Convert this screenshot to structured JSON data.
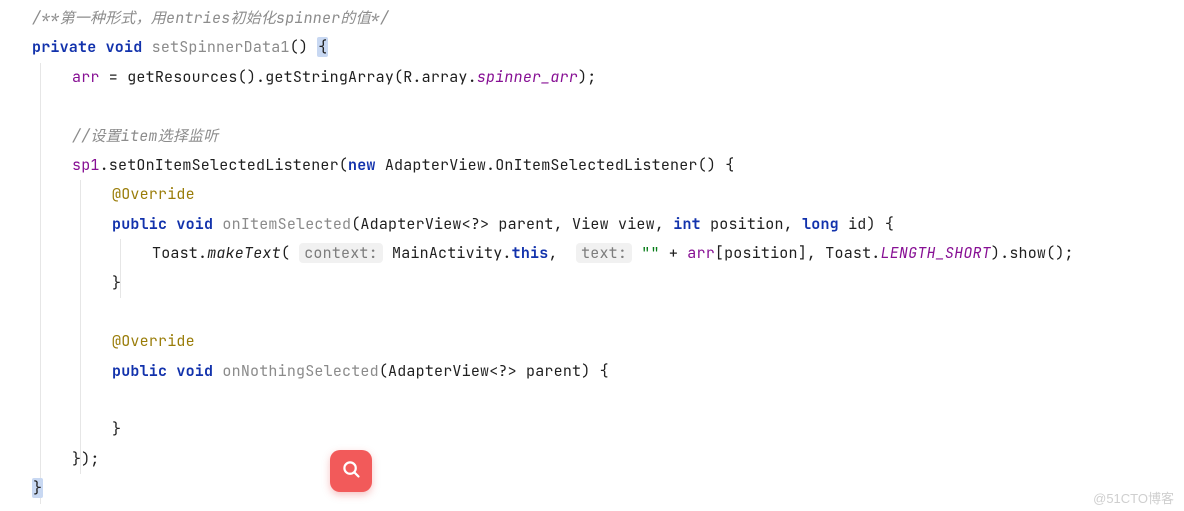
{
  "watermark": "@51CTO博客",
  "button": {
    "name": "search"
  },
  "code": {
    "lines": [
      {
        "indent": 0,
        "hl": false,
        "tokens": [
          {
            "cls": "c-comment",
            "t": "/**第一种形式，用entries初始化spinner的值*/"
          }
        ]
      },
      {
        "indent": 0,
        "hl": false,
        "tokens": [
          {
            "cls": "c-kw",
            "t": "private "
          },
          {
            "cls": "c-kw",
            "t": "void "
          },
          {
            "cls": "c-decl",
            "t": "setSpinnerData1"
          },
          {
            "cls": "c-punc",
            "t": "() "
          },
          {
            "cls": "c-punc hl-brace",
            "t": "{"
          }
        ]
      },
      {
        "indent": 1,
        "hl": false,
        "tokens": [
          {
            "cls": "c-field",
            "t": "arr"
          },
          {
            "cls": "c-punc",
            "t": " = "
          },
          {
            "cls": "c-method",
            "t": "getResources().getStringArray(R.array."
          },
          {
            "cls": "c-staticit",
            "t": "spinner_arr"
          },
          {
            "cls": "c-punc",
            "t": ");"
          }
        ]
      },
      {
        "indent": 1,
        "hl": false,
        "tokens": [
          {
            "cls": "c-punc",
            "t": ""
          }
        ]
      },
      {
        "indent": 1,
        "hl": false,
        "tokens": [
          {
            "cls": "c-comment",
            "t": "//设置item选择监听"
          }
        ]
      },
      {
        "indent": 1,
        "hl": false,
        "tokens": [
          {
            "cls": "c-field",
            "t": "sp1"
          },
          {
            "cls": "c-punc",
            "t": ".setOnItemSelectedListener("
          },
          {
            "cls": "c-kw",
            "t": "new "
          },
          {
            "cls": "c-ident",
            "t": "AdapterView.OnItemSelectedListener() {"
          }
        ]
      },
      {
        "indent": 2,
        "hl": false,
        "tokens": [
          {
            "cls": "c-anno",
            "t": "@Override"
          }
        ]
      },
      {
        "indent": 2,
        "hl": false,
        "tokens": [
          {
            "cls": "c-kw",
            "t": "public "
          },
          {
            "cls": "c-kw",
            "t": "void "
          },
          {
            "cls": "c-decl",
            "t": "onItemSelected"
          },
          {
            "cls": "c-punc",
            "t": "(AdapterView<?> parent, View view, "
          },
          {
            "cls": "c-kw",
            "t": "int "
          },
          {
            "cls": "c-ident",
            "t": "position, "
          },
          {
            "cls": "c-kw",
            "t": "long "
          },
          {
            "cls": "c-ident",
            "t": "id) {"
          }
        ]
      },
      {
        "indent": 3,
        "hl": false,
        "tokens": [
          {
            "cls": "c-ident",
            "t": "Toast."
          },
          {
            "cls": "c-static",
            "t": "makeText"
          },
          {
            "cls": "c-punc",
            "t": "( "
          },
          {
            "cls": "c-hint",
            "t": "context:"
          },
          {
            "cls": "c-punc",
            "t": " MainActivity."
          },
          {
            "cls": "c-kw",
            "t": "this"
          },
          {
            "cls": "c-punc",
            "t": ",  "
          },
          {
            "cls": "c-hint",
            "t": "text:"
          },
          {
            "cls": "c-punc",
            "t": " "
          },
          {
            "cls": "c-str",
            "t": "\"\""
          },
          {
            "cls": "c-punc",
            "t": " + "
          },
          {
            "cls": "c-field",
            "t": "arr"
          },
          {
            "cls": "c-punc",
            "t": "[position], Toast."
          },
          {
            "cls": "c-staticit",
            "t": "LENGTH_SHORT"
          },
          {
            "cls": "c-punc",
            "t": ").show();"
          }
        ]
      },
      {
        "indent": 2,
        "hl": false,
        "tokens": [
          {
            "cls": "c-punc",
            "t": "}"
          }
        ]
      },
      {
        "indent": 2,
        "hl": false,
        "tokens": [
          {
            "cls": "c-punc",
            "t": ""
          }
        ]
      },
      {
        "indent": 2,
        "hl": false,
        "tokens": [
          {
            "cls": "c-anno",
            "t": "@Override"
          }
        ]
      },
      {
        "indent": 2,
        "hl": false,
        "tokens": [
          {
            "cls": "c-kw",
            "t": "public "
          },
          {
            "cls": "c-kw",
            "t": "void "
          },
          {
            "cls": "c-decl",
            "t": "onNothingSelected"
          },
          {
            "cls": "c-punc",
            "t": "(AdapterView<?> parent) {"
          }
        ]
      },
      {
        "indent": 2,
        "hl": false,
        "tokens": [
          {
            "cls": "c-punc",
            "t": ""
          }
        ]
      },
      {
        "indent": 2,
        "hl": false,
        "tokens": [
          {
            "cls": "c-punc",
            "t": "}"
          }
        ]
      },
      {
        "indent": 1,
        "hl": false,
        "tokens": [
          {
            "cls": "c-punc",
            "t": "});"
          }
        ]
      },
      {
        "indent": 0,
        "hl": true,
        "tokens": [
          {
            "cls": "c-punc hl-brace",
            "t": "}"
          }
        ]
      }
    ]
  }
}
